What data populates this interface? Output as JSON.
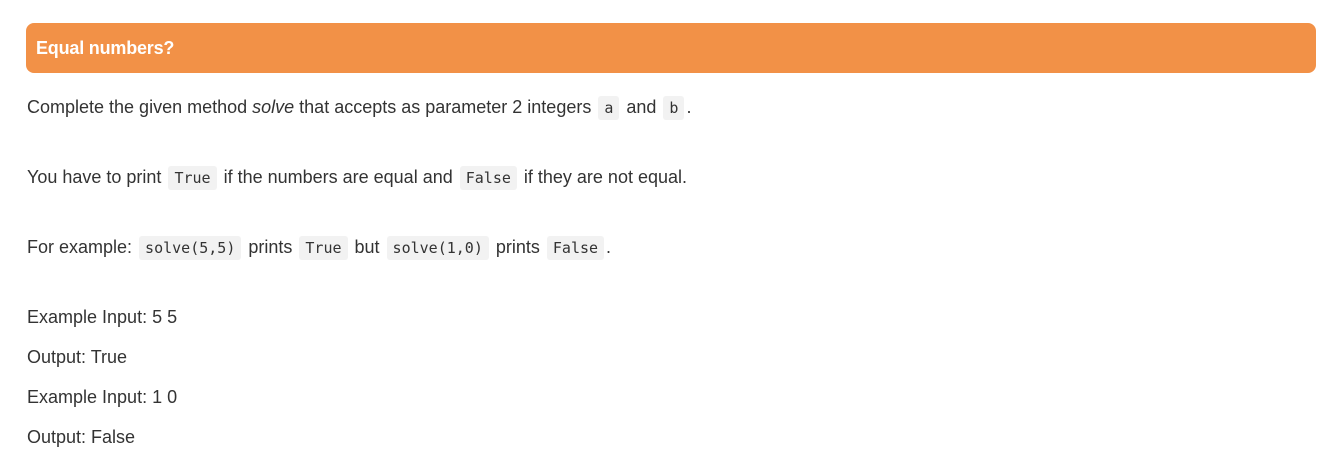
{
  "header": {
    "title": "Equal numbers?",
    "color": "#f29147"
  },
  "paragraph1": {
    "before_em": "Complete the given method ",
    "em": "solve",
    "after_em": " that accepts as parameter 2 integers ",
    "code_a": "a",
    "mid": " and ",
    "code_b": "b",
    "end": "."
  },
  "paragraph2": {
    "start": "You have to print ",
    "code_true": "True",
    "mid": " if the numbers are equal and ",
    "code_false": "False",
    "end": " if they are not equal."
  },
  "paragraph3": {
    "start": "For example: ",
    "code1": "solve(5,5)",
    "t1": " prints ",
    "code2": "True",
    "t2": " but ",
    "code3": "solve(1,0)",
    "t3": " prints ",
    "code4": "False",
    "end": "."
  },
  "examples": {
    "input1": "Example Input: 5 5",
    "output1": "Output: True",
    "input2": "Example Input: 1 0",
    "output2": "Output: False"
  }
}
